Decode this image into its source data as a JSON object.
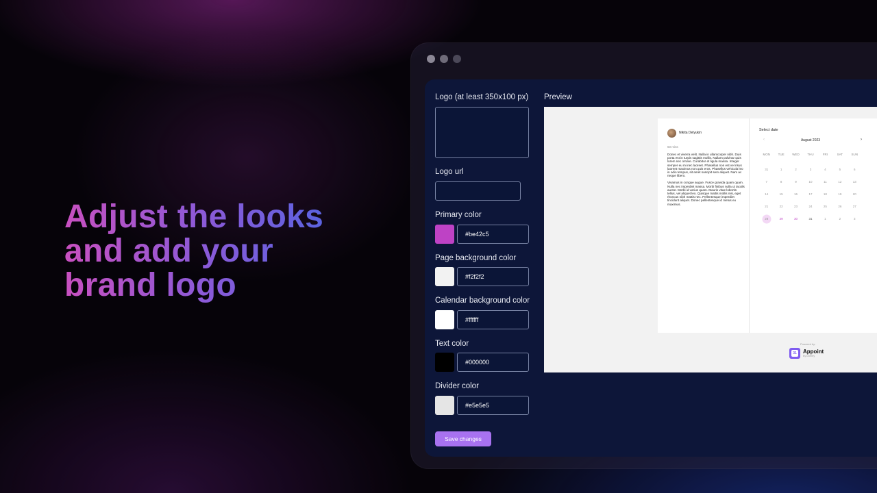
{
  "headline": {
    "line1": "Adjust the looks",
    "line2": "and add your",
    "line3": "brand logo"
  },
  "form": {
    "logo_label": "Logo (at least 350x100 px)",
    "logo_url_label": "Logo url",
    "logo_url_value": "",
    "primary_color_label": "Primary color",
    "primary_color_value": "#be42c5",
    "page_bg_label": "Page background color",
    "page_bg_value": "#f2f2f2",
    "calendar_bg_label": "Calendar background color",
    "calendar_bg_value": "#ffffff",
    "text_color_label": "Text color",
    "text_color_value": "#000000",
    "divider_color_label": "Divider color",
    "divider_color_value": "#e5e5e5",
    "save_label": "Save changes"
  },
  "preview": {
    "label": "Preview",
    "host_name": "Nikita Delyukin",
    "duration": "60 mins",
    "description_1": "Donec et viverra velit. Nulla in ullamcorper nibh. Duis porta est in turpis sagittis mollis. Nullam pulvinar quis lorem nec ornare. Curabitur et ligula massa. Integer semper eu mi nec laoreet. Phasellus non est vel risus laoreet maximus non quis eros. Phasellus vehicula leo in odio tempus, sit amet suscipit sem aliquet. Nam ac neque libero.",
    "description_2": "Vivamus in congue augue. Fusce gravida quam quam. Nulla nec imperdiet massa. Morbi finibus nulla ut iaculis auctor. Morbi id varius quam. Mauris vitae lobortis tellus, vel aliquet leo. Quisque mattis mollis nisi, eget rhoncus nibh mattis nec. Pellentesque imperdiet tincidunt aliquet. Donec pellentesque id metus eu maximus.",
    "select_date": "Select date",
    "month": "August 2023",
    "prev_icon": "‹",
    "next_icon": "›",
    "weekdays": [
      "MON",
      "TUE",
      "WED",
      "THU",
      "FRI",
      "SAT",
      "SUN"
    ],
    "weeks": [
      [
        "31",
        "1",
        "2",
        "3",
        "4",
        "5",
        "6"
      ],
      [
        "7",
        "8",
        "9",
        "10",
        "11",
        "12",
        "13"
      ],
      [
        "14",
        "15",
        "16",
        "17",
        "18",
        "19",
        "20"
      ],
      [
        "21",
        "22",
        "23",
        "24",
        "25",
        "26",
        "27"
      ],
      [
        "28",
        "29",
        "30",
        "31",
        "1",
        "2",
        "3"
      ]
    ],
    "powered_by": "Powered by:",
    "brand_name": "Appoint",
    "brand_sub": "By Dcentry",
    "brand_icon_text": "31"
  },
  "colors": {
    "primary": "#be42c5",
    "save_button": "#a872f0",
    "panel_bg": "#0d1639"
  },
  "icons": {
    "window_dots": [
      "window-dot-icon",
      "window-dot-icon",
      "window-dot-icon"
    ],
    "brand": "calendar-icon"
  }
}
